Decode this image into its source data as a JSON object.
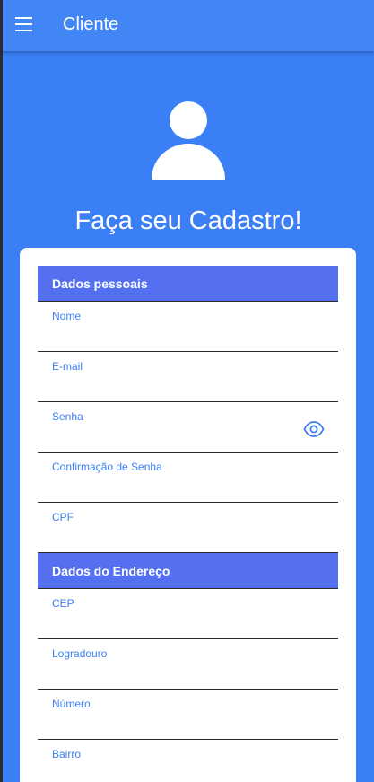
{
  "appbar": {
    "menu_icon": "hamburger-menu-icon",
    "title": "Cliente"
  },
  "hero": {
    "avatar_icon": "person-icon",
    "title": "Faça seu Cadastro!"
  },
  "form": {
    "personal_section": {
      "title": "Dados pessoais",
      "fields": [
        {
          "label": "Nome",
          "value": ""
        },
        {
          "label": "E-mail",
          "value": ""
        },
        {
          "label": "Senha",
          "value": "",
          "icon": "eye-icon"
        },
        {
          "label": "Confirmação de Senha",
          "value": ""
        },
        {
          "label": "CPF",
          "value": ""
        }
      ]
    },
    "address_section": {
      "title": "Dados do Endereço",
      "fields": [
        {
          "label": "CEP",
          "value": ""
        },
        {
          "label": "Logradouro",
          "value": ""
        },
        {
          "label": "Número",
          "value": ""
        },
        {
          "label": "Bairro",
          "value": ""
        }
      ]
    }
  },
  "colors": {
    "background": "#3a7ff5",
    "appbar": "#4285f4",
    "section_header": "#5470f0",
    "label": "#3a7ff5"
  }
}
